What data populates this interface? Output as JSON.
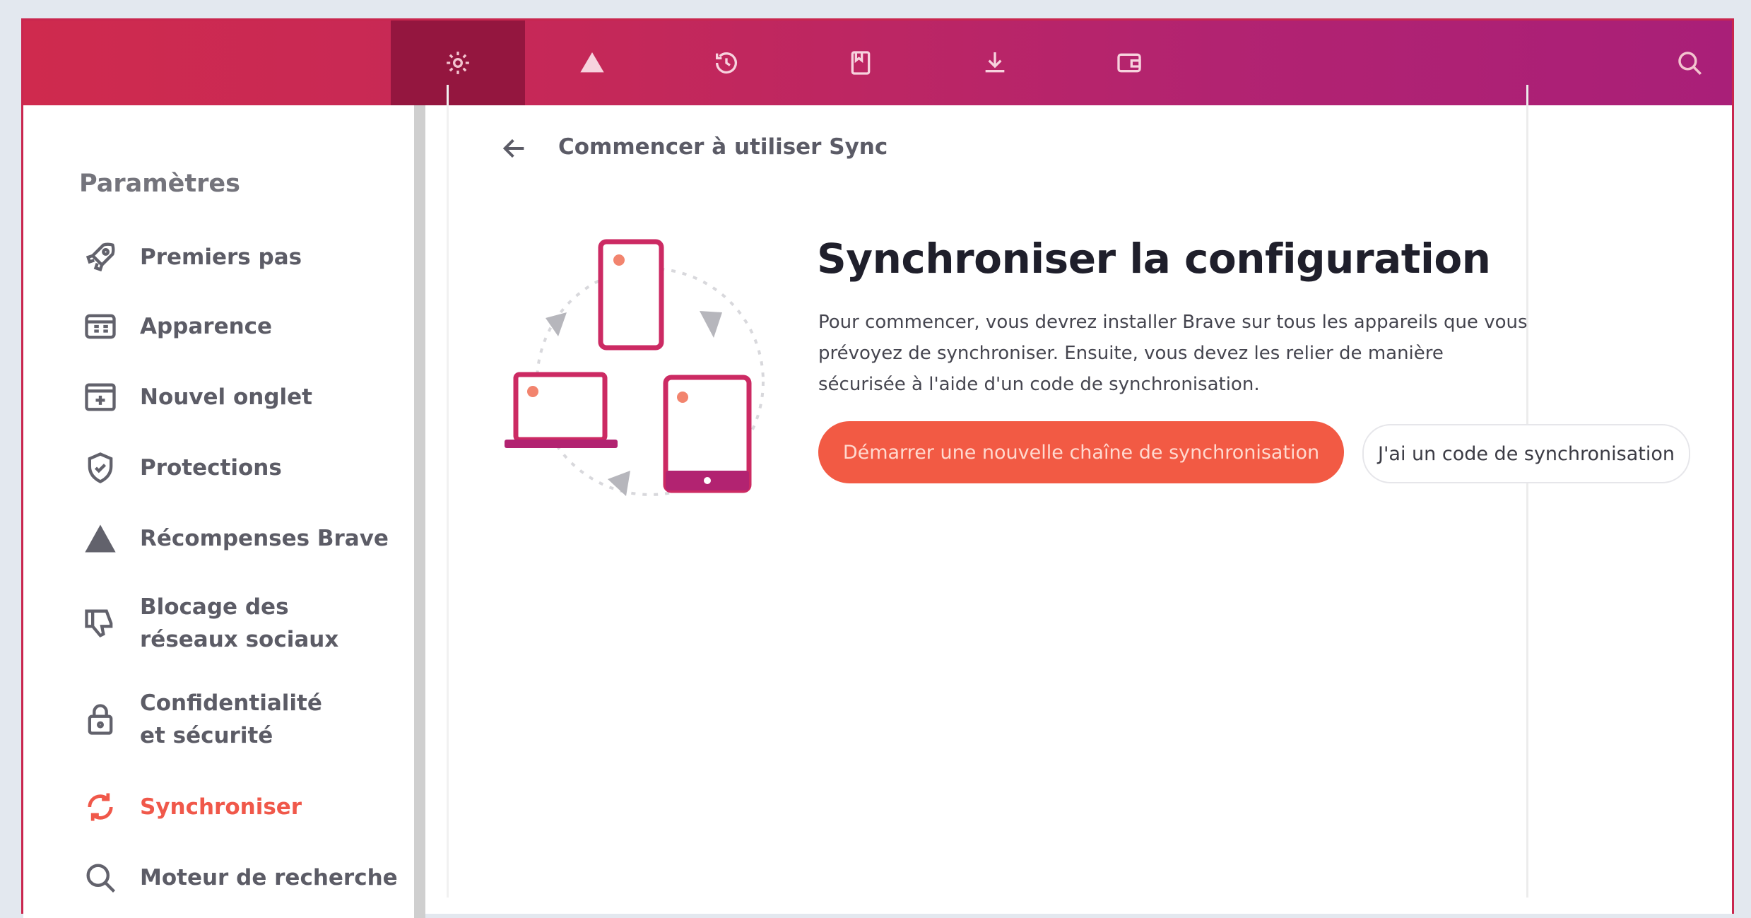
{
  "toolbar": {
    "tabs": [
      {
        "icon": "gear-icon",
        "active": true
      },
      {
        "icon": "brave-rewards-icon",
        "active": false
      },
      {
        "icon": "history-icon",
        "active": false
      },
      {
        "icon": "bookmarks-icon",
        "active": false
      },
      {
        "icon": "downloads-icon",
        "active": false
      },
      {
        "icon": "wallet-icon",
        "active": false
      }
    ],
    "search_icon": "search-icon"
  },
  "sidebar": {
    "title": "Paramètres",
    "items": [
      {
        "label": "Premiers pas",
        "icon": "rocket-icon"
      },
      {
        "label": "Apparence",
        "icon": "appearance-icon"
      },
      {
        "label": "Nouvel onglet",
        "icon": "new-tab-icon"
      },
      {
        "label": "Protections",
        "icon": "shield-icon"
      },
      {
        "label": "Récompenses Brave",
        "icon": "triangle-icon"
      },
      {
        "label": "Blocage des réseaux sociaux",
        "icon": "thumbs-down-icon"
      },
      {
        "label": "Confidentialité et sécurité",
        "icon": "lock-icon"
      },
      {
        "label": "Synchroniser",
        "icon": "sync-icon",
        "active": true
      },
      {
        "label": "Moteur de recherche",
        "icon": "search-icon"
      }
    ]
  },
  "main": {
    "breadcrumb": "Commencer à utiliser Sync",
    "heading": "Synchroniser la configuration",
    "description": "Pour commencer, vous devrez installer Brave sur tous les appareils que vous prévoyez de synchroniser. Ensuite, vous devez les relier de manière sécurisée à l'aide d'un code de synchronisation.",
    "primary_button": "Démarrer une nouvelle chaîne de synchronisation",
    "secondary_button": "J'ai un code de synchronisation"
  },
  "colors": {
    "toolbar_start": "#cf2a4e",
    "toolbar_end": "#a91f78",
    "active_tab": "#94163f",
    "accent": "#f25a44",
    "active_nav": "#f0584a"
  }
}
